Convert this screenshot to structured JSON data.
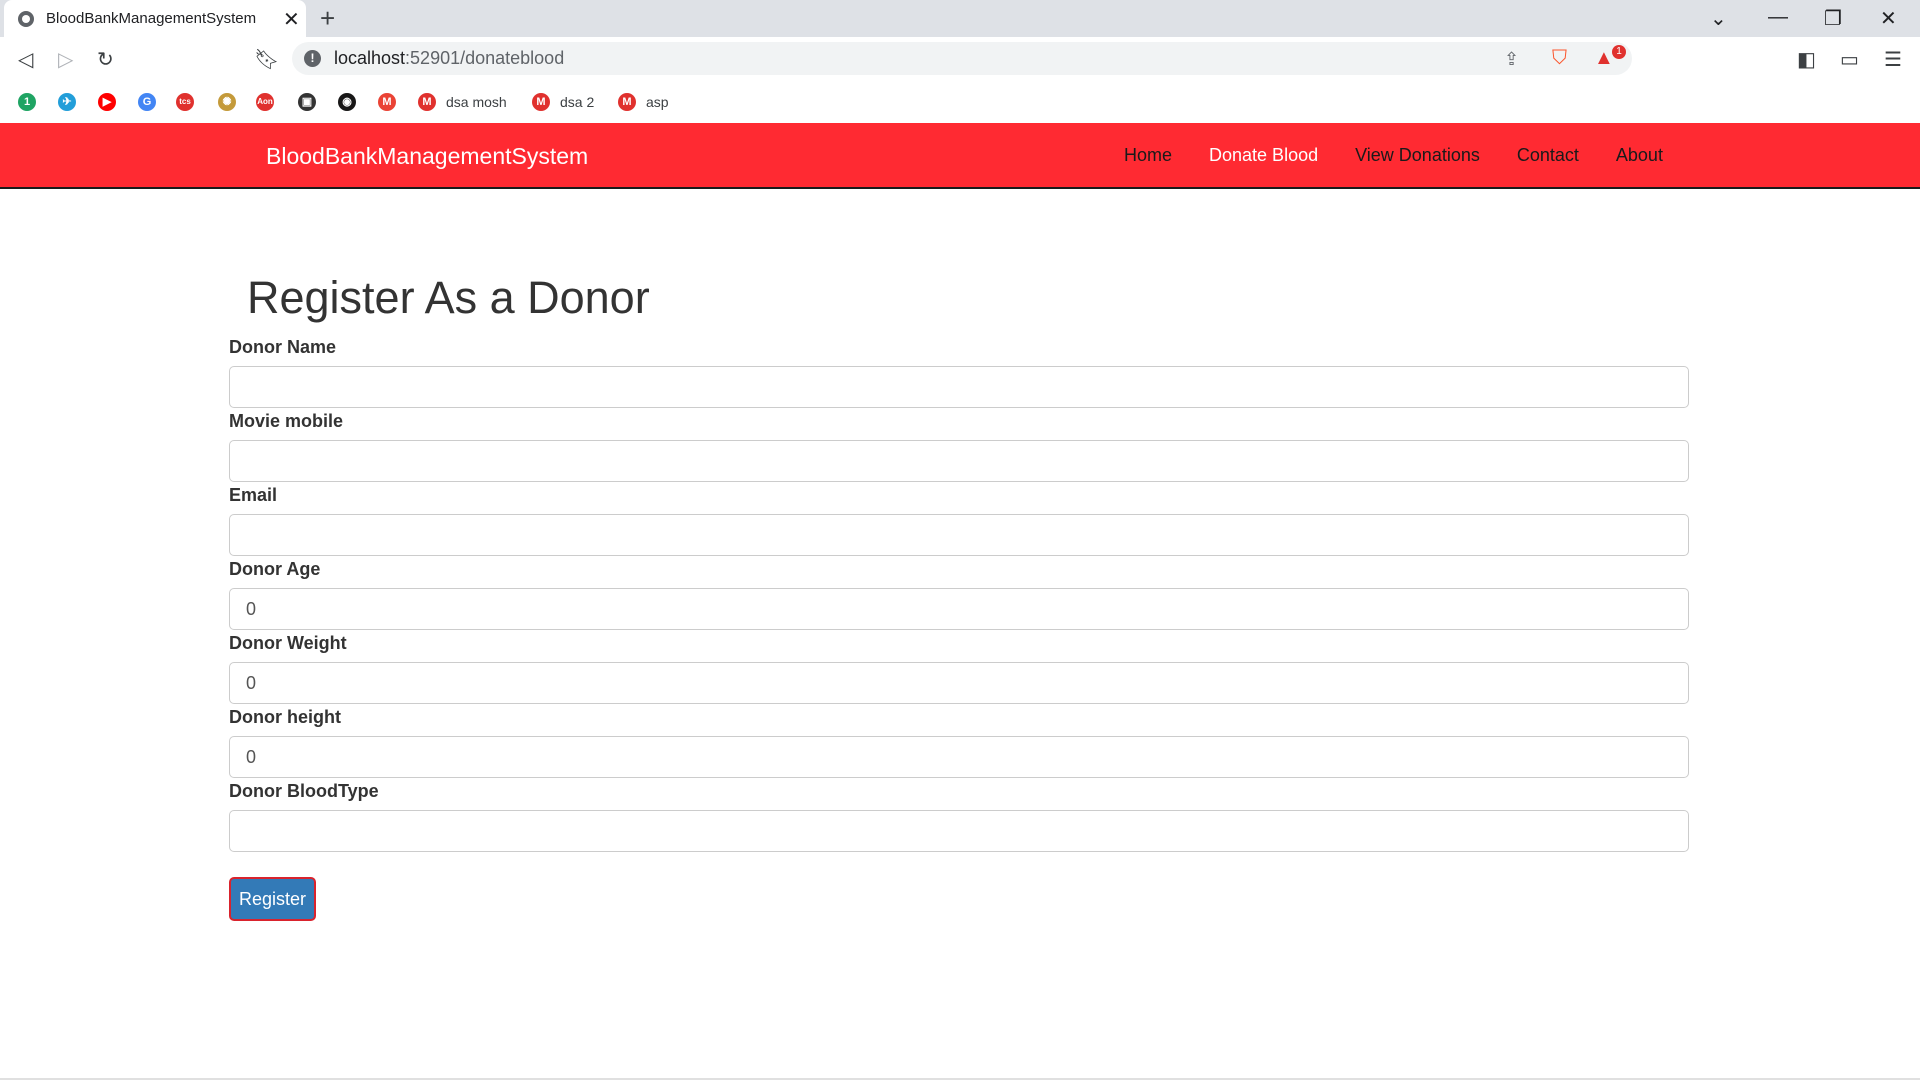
{
  "browser": {
    "tab_title": "BloodBankManagementSystem",
    "url_host": "localhost",
    "url_path": ":52901/donateblood",
    "brave_badge": "1",
    "bookmarks": [
      {
        "label": "",
        "color": "#1fa463",
        "glyph": "1"
      },
      {
        "label": "",
        "color": "#229ed9",
        "glyph": "✈"
      },
      {
        "label": "",
        "color": "#ff0000",
        "glyph": "▶"
      },
      {
        "label": "",
        "color": "#4285f4",
        "glyph": "G"
      },
      {
        "label": "",
        "color": "#e0312e",
        "glyph": "tcs"
      },
      {
        "label": "",
        "color": "#c49a3a",
        "glyph": "✺"
      },
      {
        "label": "",
        "color": "#e0312e",
        "glyph": "Aon"
      },
      {
        "label": "",
        "color": "#333333",
        "glyph": "▣"
      },
      {
        "label": "",
        "color": "#181717",
        "glyph": "◉"
      },
      {
        "label": "",
        "color": "#ea4335",
        "glyph": "M"
      },
      {
        "label": "dsa mosh",
        "color": "#e0312e",
        "glyph": "M"
      },
      {
        "label": "dsa 2",
        "color": "#e0312e",
        "glyph": "M"
      },
      {
        "label": "asp",
        "color": "#e0312e",
        "glyph": "M"
      }
    ]
  },
  "navbar": {
    "brand": "BloodBankManagementSystem",
    "links": [
      "Home",
      "Donate Blood",
      "View Donations",
      "Contact",
      "About"
    ]
  },
  "form": {
    "title": "Register As a Donor",
    "fields": [
      {
        "label": "Donor Name",
        "value": ""
      },
      {
        "label": "Movie mobile",
        "value": ""
      },
      {
        "label": "Email",
        "value": ""
      },
      {
        "label": "Donor Age",
        "value": "0"
      },
      {
        "label": "Donor Weight",
        "value": "0"
      },
      {
        "label": "Donor height",
        "value": "0"
      },
      {
        "label": "Donor BloodType",
        "value": ""
      }
    ],
    "submit_label": "Register"
  },
  "colors": {
    "navbar": "#ff2a32",
    "button": "#337ab7",
    "button_border": "#d9232d"
  }
}
